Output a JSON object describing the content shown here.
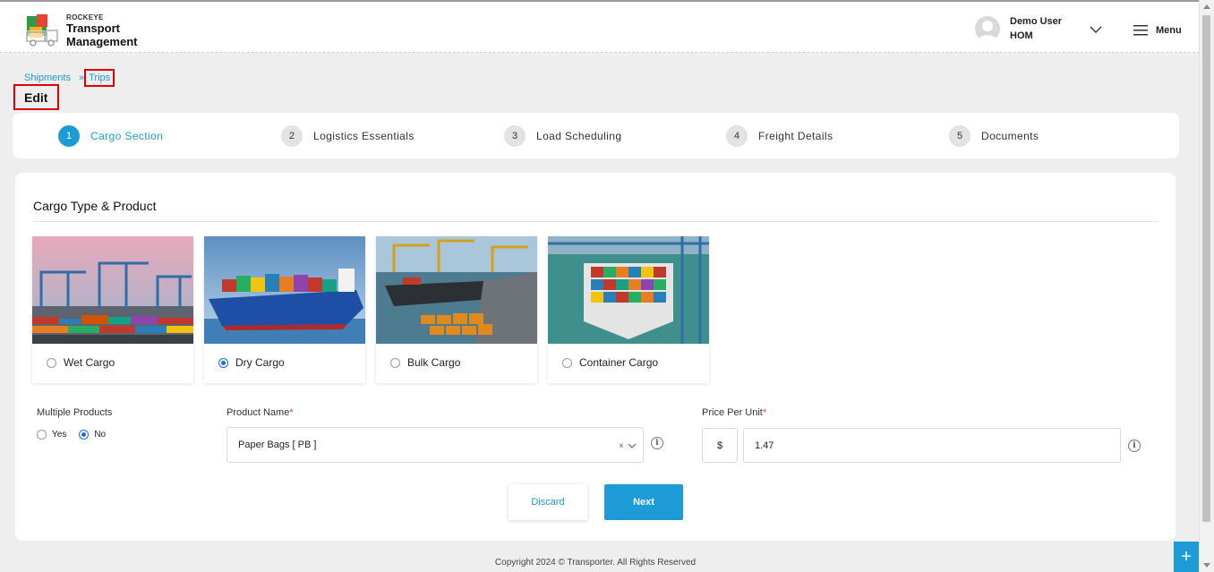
{
  "header": {
    "brand_small": "ROCKEYE",
    "brand_line1": "Transport",
    "brand_line2": "Management",
    "user_name": "Demo User",
    "user_code": "HOM",
    "menu_label": "Menu"
  },
  "breadcrumb": {
    "items": [
      "Shipments",
      "Trips"
    ],
    "separator": "»"
  },
  "page_title": "Edit",
  "steps": [
    {
      "num": "1",
      "label": "Cargo Section",
      "active": true
    },
    {
      "num": "2",
      "label": "Logistics Essentials",
      "active": false
    },
    {
      "num": "3",
      "label": "Load Scheduling",
      "active": false
    },
    {
      "num": "4",
      "label": "Freight Details",
      "active": false
    },
    {
      "num": "5",
      "label": "Documents",
      "active": false
    }
  ],
  "form": {
    "section_title": "Cargo Type & Product",
    "cargo_types": [
      {
        "label": "Wet Cargo",
        "selected": false
      },
      {
        "label": "Dry Cargo",
        "selected": true
      },
      {
        "label": "Bulk Cargo",
        "selected": false
      },
      {
        "label": "Container Cargo",
        "selected": false
      }
    ],
    "multiple_products_label": "Multiple Products",
    "multiple_products_options": [
      {
        "label": "Yes",
        "selected": false
      },
      {
        "label": "No",
        "selected": true
      }
    ],
    "product_name_label": "Product Name",
    "product_name_value": "Paper Bags [ PB ]",
    "clear_glyph": "×",
    "price_label": "Price Per Unit",
    "currency": "$",
    "price_value": "1.47",
    "required_mark": "*",
    "info_glyph": "i"
  },
  "buttons": {
    "discard": "Discard",
    "next": "Next"
  },
  "footer": "Copyright 2024 © Transporter. All Rights Reserved",
  "fab_glyph": "+",
  "colors": {
    "accent": "#1d9bd6",
    "highlight_box": "#e00000",
    "radio_selected": "#1a6fd8",
    "required": "#e53935"
  }
}
